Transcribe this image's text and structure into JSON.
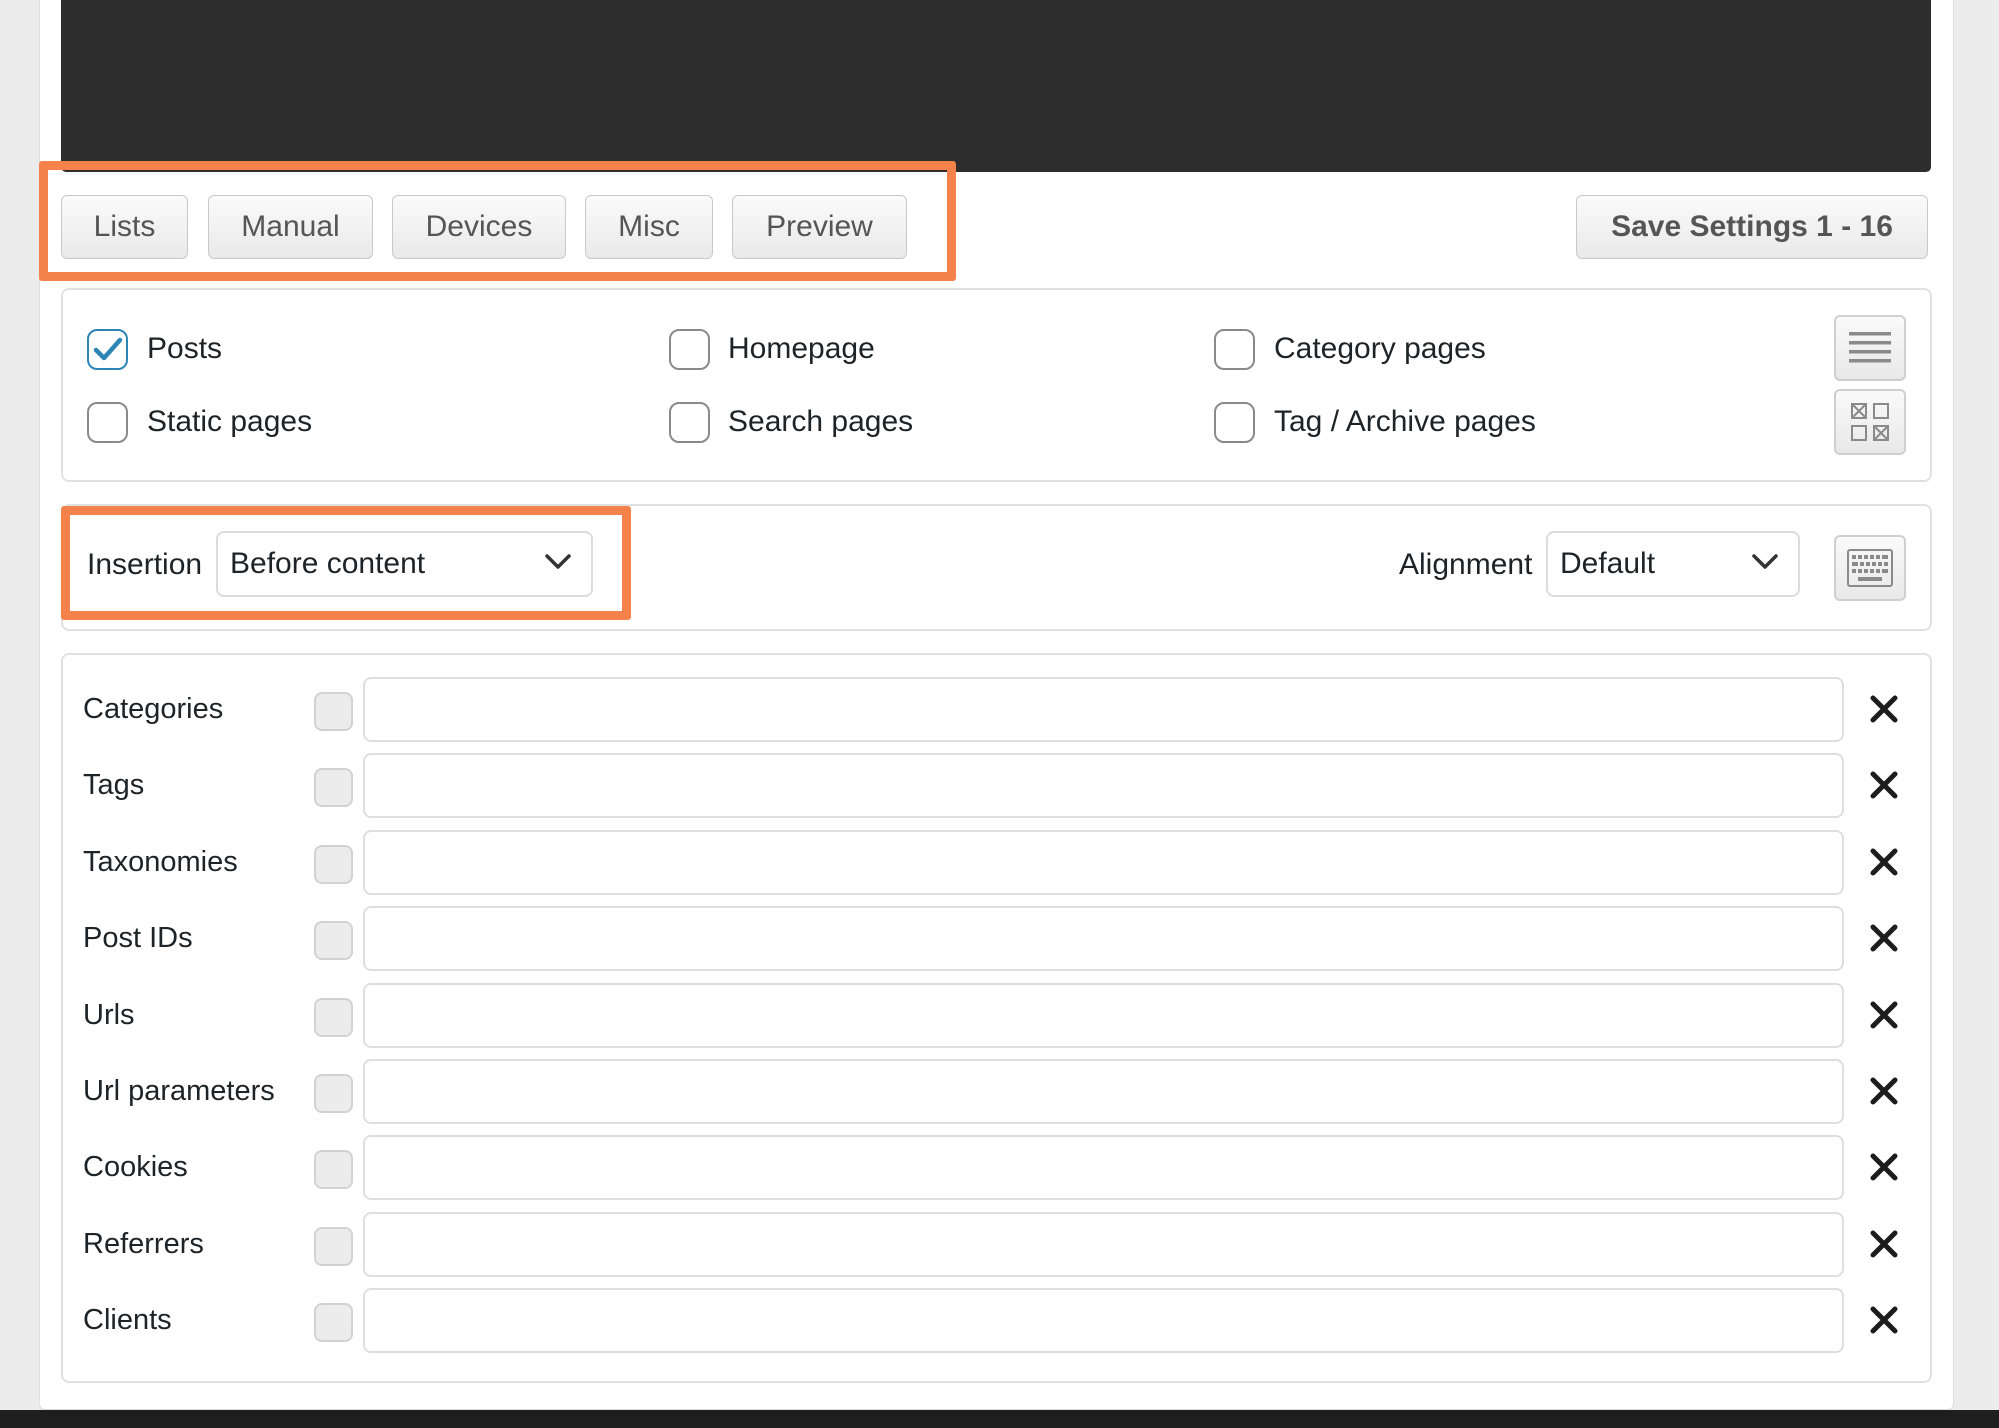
{
  "tabs": [
    {
      "id": "lists",
      "label": "Lists"
    },
    {
      "id": "manual",
      "label": "Manual"
    },
    {
      "id": "devices",
      "label": "Devices"
    },
    {
      "id": "misc",
      "label": "Misc"
    },
    {
      "id": "preview",
      "label": "Preview"
    }
  ],
  "save_button": {
    "label": "Save Settings 1 - 16"
  },
  "page_types": [
    {
      "label": "Posts",
      "checked": true
    },
    {
      "label": "Homepage",
      "checked": false
    },
    {
      "label": "Category pages",
      "checked": false
    },
    {
      "label": "Static pages",
      "checked": false
    },
    {
      "label": "Search pages",
      "checked": false
    },
    {
      "label": "Tag / Archive pages",
      "checked": false
    }
  ],
  "insertion": {
    "label": "Insertion",
    "value": "Before content"
  },
  "alignment": {
    "label": "Alignment",
    "value": "Default"
  },
  "filters": [
    {
      "label": "Categories",
      "value": ""
    },
    {
      "label": "Tags",
      "value": ""
    },
    {
      "label": "Taxonomies",
      "value": ""
    },
    {
      "label": "Post IDs",
      "value": ""
    },
    {
      "label": "Urls",
      "value": ""
    },
    {
      "label": "Url parameters",
      "value": ""
    },
    {
      "label": "Cookies",
      "value": ""
    },
    {
      "label": "Referrers",
      "value": ""
    },
    {
      "label": "Clients",
      "value": ""
    }
  ],
  "icons": {
    "list_view": "list-view-icon",
    "grid_view": "grid-view-icon",
    "keyboard": "keyboard-icon",
    "remove": "close-icon",
    "dropdown": "chevron-down-icon"
  },
  "colors": {
    "highlight": "#f5824a",
    "checkmark": "#2d85b5",
    "editor_bg": "#2d2d2d"
  }
}
